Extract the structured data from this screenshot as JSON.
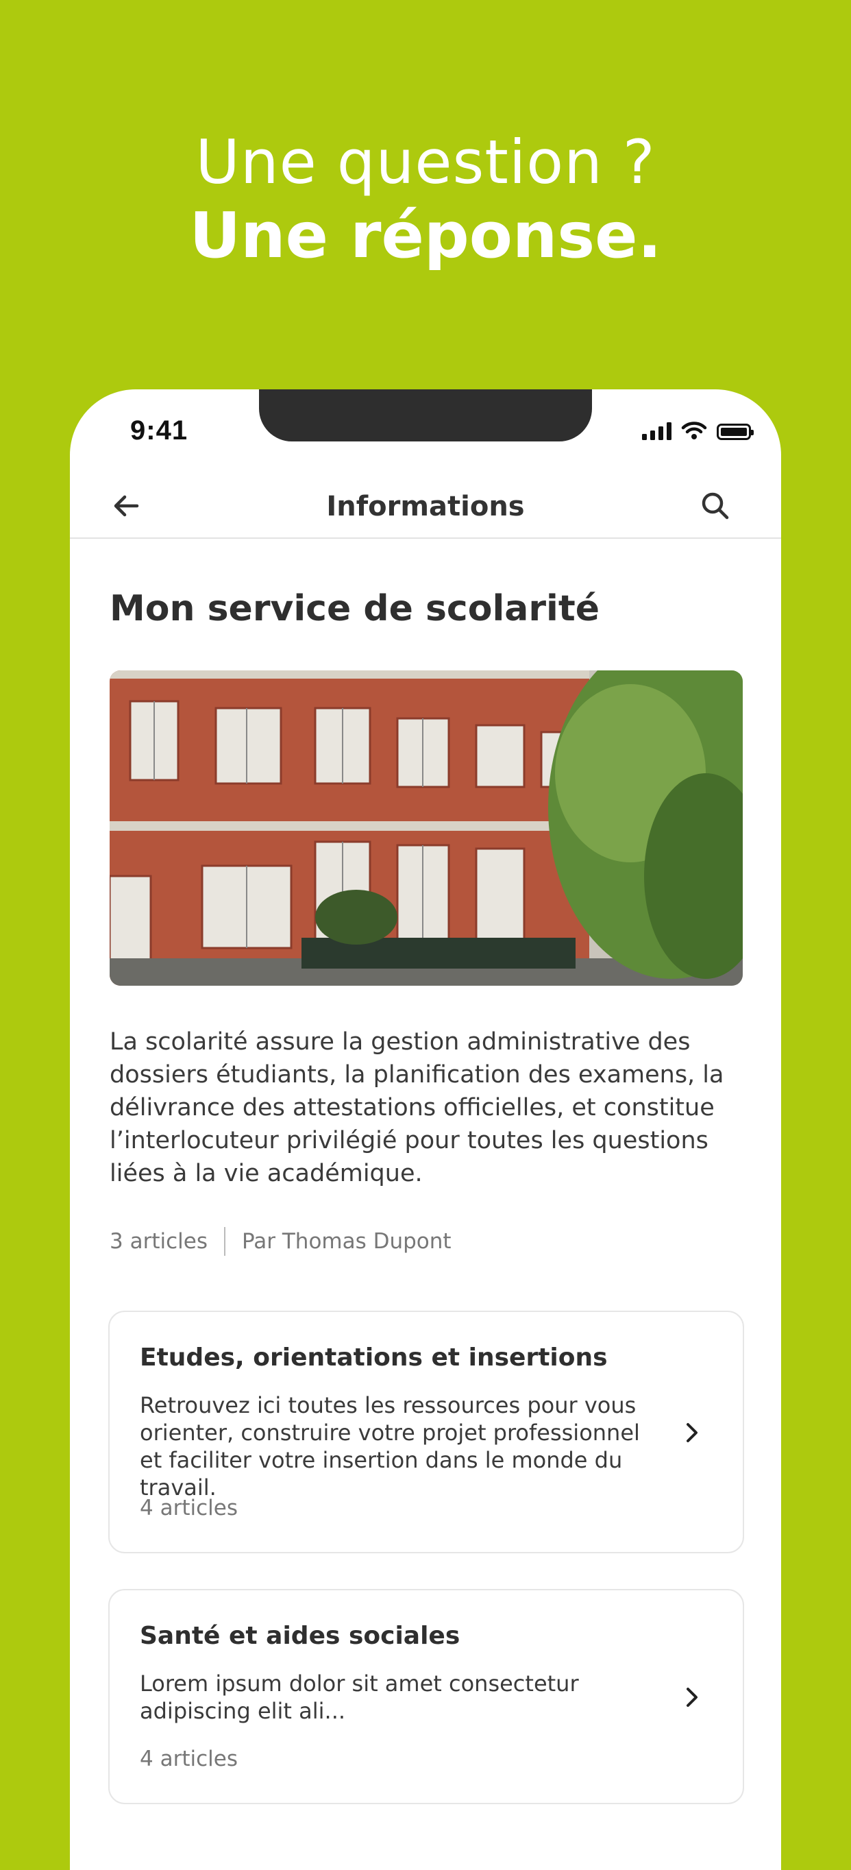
{
  "promo": {
    "line1": "Une question ?",
    "line2": "Une réponse."
  },
  "status_bar": {
    "time": "9:41"
  },
  "nav": {
    "title": "Informations",
    "back_icon": "arrow-left-icon",
    "search_icon": "search-icon"
  },
  "page": {
    "title": "Mon service de scolarité",
    "description": "La scolarité assure la gestion administrative des dossiers étudiants, la planification des examens, la délivrance des attestations officielles, et constitue l’interlocuteur privilégié pour toutes les questions liées à la vie académique.",
    "article_count": "3 articles",
    "author": "Par Thomas Dupont"
  },
  "cards": [
    {
      "title": "Etudes, orientations et insertions",
      "description": "Retrouvez ici toutes les ressources pour vous orienter, construire votre projet professionnel et faciliter votre insertion dans le monde du travail.",
      "count": "4 articles"
    },
    {
      "title": "Santé et aides sociales",
      "description": "Lorem ipsum dolor sit amet consectetur adipiscing elit ali...",
      "count": "4 articles"
    }
  ],
  "colors": {
    "background": "#adca0e",
    "surface": "#ffffff",
    "text": "#2f2f2f",
    "muted": "#777777"
  }
}
